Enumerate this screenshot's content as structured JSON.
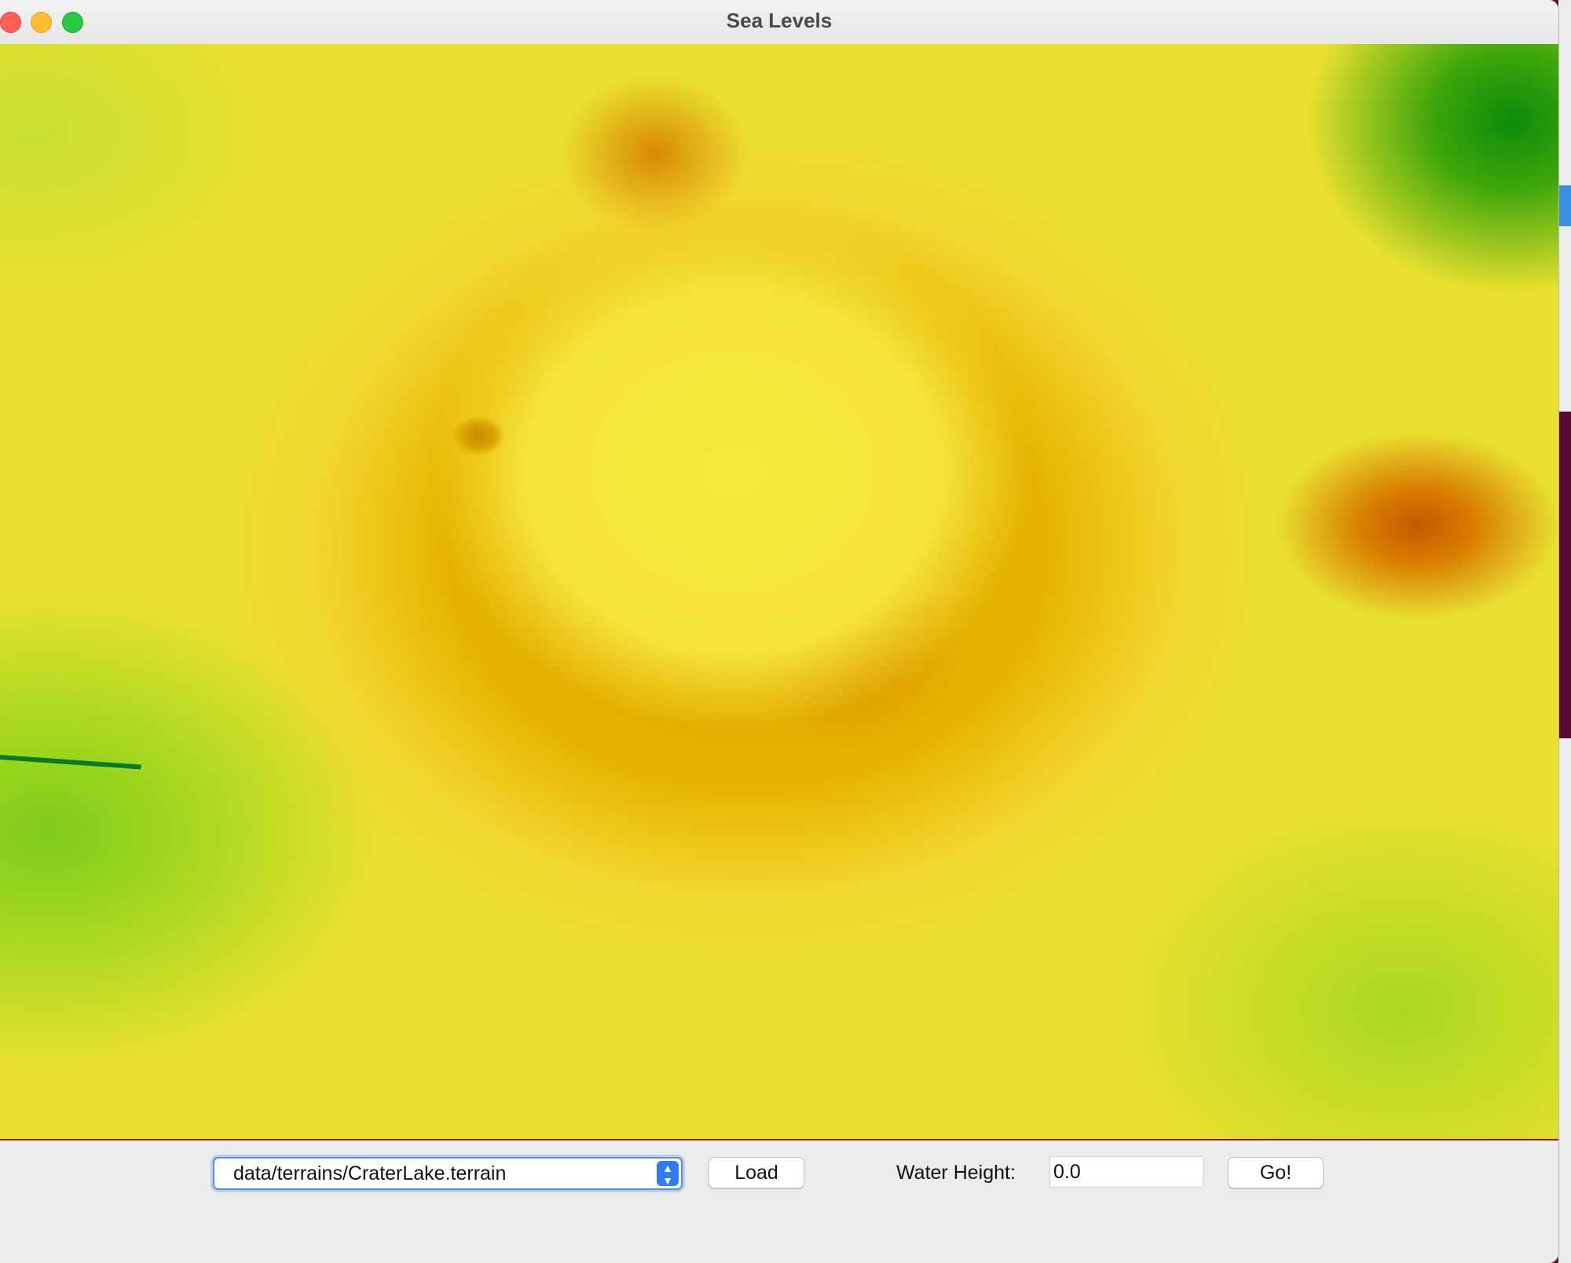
{
  "window": {
    "title": "Sea Levels"
  },
  "map": {
    "description_colors": {
      "low": "#1f8a1f",
      "mid": "#f5e33a",
      "high": "#c25a00"
    }
  },
  "controls": {
    "terrain_file": "data/terrains/CraterLake.terrain",
    "load_label": "Load",
    "water_height_label": "Water Height:",
    "water_height_value": "0.0",
    "go_label": "Go!"
  }
}
